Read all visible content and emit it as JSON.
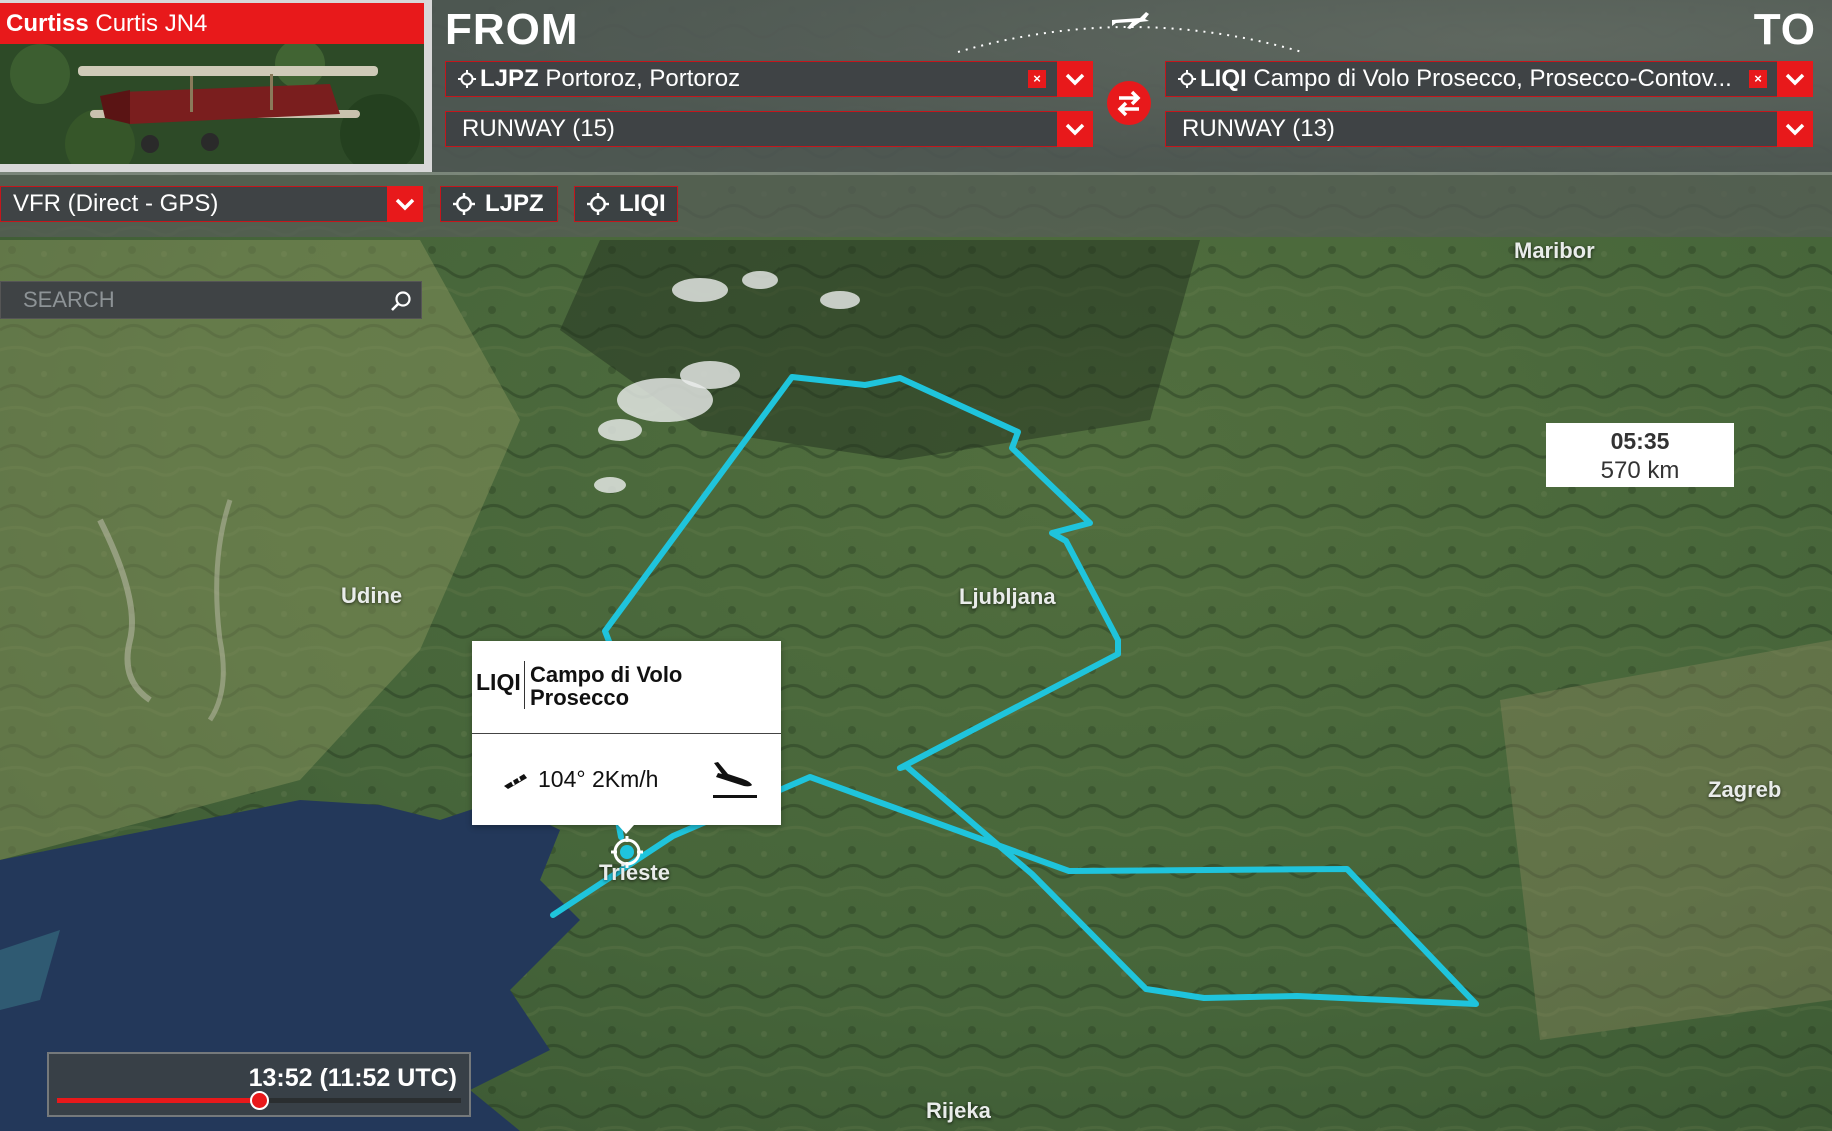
{
  "aircraft": {
    "brand": "Curtiss",
    "model": "Curtis JN4"
  },
  "from": {
    "heading": "FROM",
    "airport_code": "LJPZ",
    "airport_name": "Portoroz, Portoroz",
    "runway": "RUNWAY (15)"
  },
  "to": {
    "heading": "TO",
    "airport_code": "LIQI",
    "airport_name": "Campo di Volo Prosecco, Prosecco-Contov...",
    "runway": "RUNWAY (13)"
  },
  "flight_type": "VFR (Direct - GPS)",
  "chips": [
    "LJPZ",
    "LIQI"
  ],
  "search": {
    "placeholder": "SEARCH"
  },
  "popup": {
    "code": "LIQI",
    "name_line1": "Campo di Volo",
    "name_line2": "Prosecco",
    "wind": "104° 2Km/h"
  },
  "map_labels": {
    "maribor": "Maribor",
    "udine": "Udine",
    "ljubljana": "Ljubljana",
    "zagreb": "Zagreb",
    "trieste": "Trieste",
    "rijeka": "Rijeka"
  },
  "eta": {
    "time": "05:35",
    "distance": "570 km"
  },
  "time_slider": {
    "label": "13:52 (11:52 UTC)",
    "progress": 0.5
  },
  "colors": {
    "accent": "#e8191b",
    "route": "#1fc4dc",
    "panel": "#3f4345"
  },
  "icons": [
    "locate-icon",
    "close-icon",
    "chevron-down-icon",
    "swap-icon",
    "airplane-icon",
    "search-icon",
    "windsock-icon",
    "landing-icon"
  ]
}
